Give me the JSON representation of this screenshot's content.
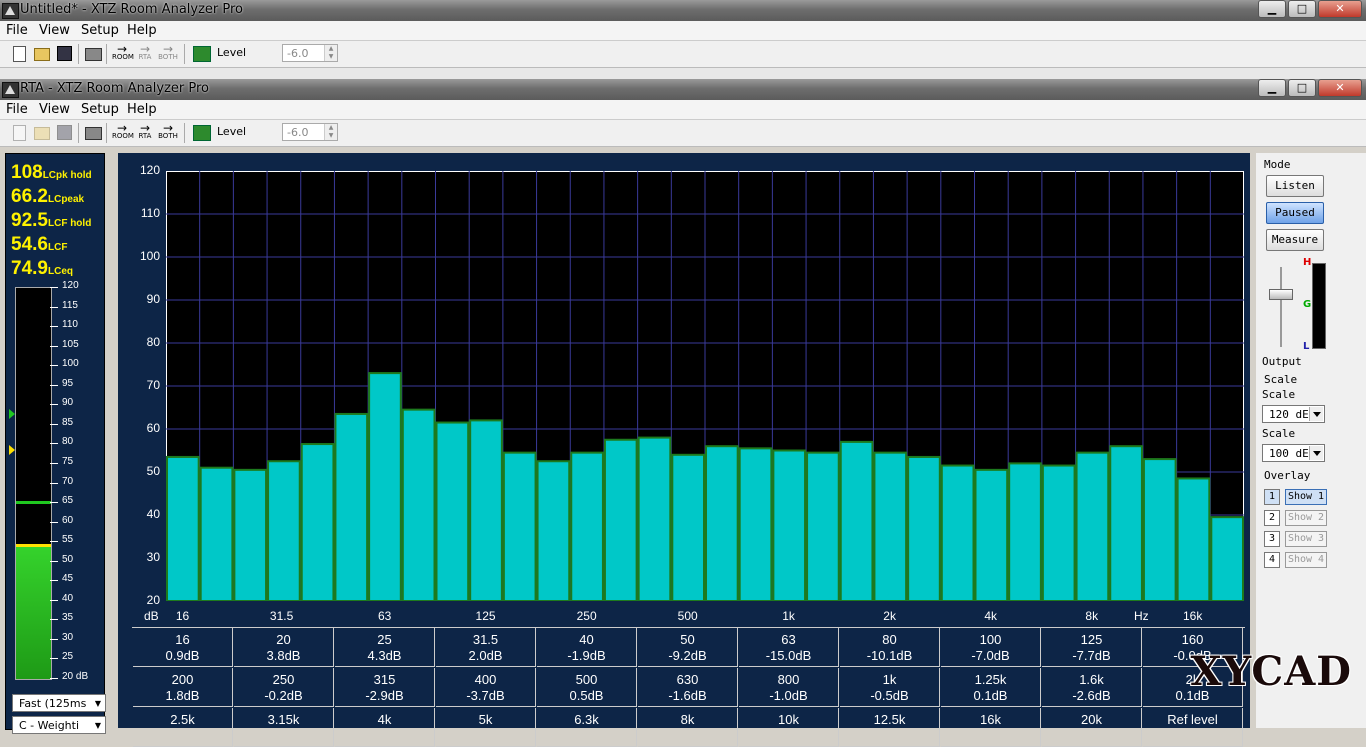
{
  "outer_window": {
    "title": "Untitled* - XTZ Room Analyzer Pro"
  },
  "inner_window": {
    "title": "RTA - XTZ Room Analyzer Pro"
  },
  "menus": [
    "File",
    "View",
    "Setup",
    "Help"
  ],
  "toolbar": {
    "room_label": "ROOM",
    "rta_label": "RTA",
    "both_label": "BOTH",
    "level_label": "Level",
    "level_value": "-6.0"
  },
  "meter": {
    "readouts": [
      {
        "value": "108",
        "label": "LCpk hold"
      },
      {
        "value": "66.2",
        "label": "LCpeak"
      },
      {
        "value": "92.5",
        "label": "LCF hold"
      },
      {
        "value": "54.6",
        "label": "LCF"
      },
      {
        "value": "74.9",
        "label": "LCeq"
      }
    ],
    "scale_labels": [
      "120",
      "115",
      "110",
      "105",
      "100",
      "95",
      "90",
      "85",
      "80",
      "75",
      "70",
      "65",
      "60",
      "55",
      "50",
      "45",
      "40",
      "35",
      "30",
      "25",
      "20 dB"
    ],
    "fill_level_db": 54,
    "peak_hold_db": 65,
    "speed_option": "Fast (125ms",
    "weighting_option": "C - Weighti"
  },
  "chart_data": {
    "type": "bar",
    "ylim": [
      20,
      120
    ],
    "yticks": [
      "120",
      "110",
      "100",
      "90",
      "80",
      "70",
      "60",
      "50",
      "40",
      "30",
      "20"
    ],
    "ylabel": "dB",
    "xlabel": "Hz",
    "xtick_labels": [
      "16",
      "31.5",
      "63",
      "125",
      "250",
      "500",
      "1k",
      "2k",
      "4k",
      "8k",
      "16k"
    ],
    "categories": [
      "16",
      "20",
      "25",
      "31.5",
      "40",
      "50",
      "63",
      "80",
      "100",
      "125",
      "160",
      "200",
      "250",
      "315",
      "400",
      "500",
      "630",
      "800",
      "1k",
      "1.25k",
      "1.6k",
      "2k",
      "2.5k",
      "3.15k",
      "4k",
      "5k",
      "6.3k",
      "8k",
      "10k",
      "12.5k",
      "16k",
      "20k"
    ],
    "values": [
      53.5,
      51,
      50.5,
      52.5,
      56.5,
      63.5,
      73,
      64.5,
      61.5,
      62,
      54.5,
      52.5,
      54.5,
      57.5,
      58,
      54,
      56,
      55.5,
      55,
      54.5,
      57,
      54.5,
      53.5,
      51.5,
      50.5,
      52,
      51.5,
      54.5,
      56,
      53,
      48.5,
      39.5
    ],
    "bar_color": "#00c8c8",
    "grid": true
  },
  "freq_table": [
    [
      {
        "f": "16",
        "v": "0.9dB"
      },
      {
        "f": "20",
        "v": "3.8dB"
      },
      {
        "f": "25",
        "v": "4.3dB"
      },
      {
        "f": "31.5",
        "v": "2.0dB"
      },
      {
        "f": "40",
        "v": "-1.9dB"
      },
      {
        "f": "50",
        "v": "-9.2dB"
      },
      {
        "f": "63",
        "v": "-15.0dB"
      },
      {
        "f": "80",
        "v": "-10.1dB"
      },
      {
        "f": "100",
        "v": "-7.0dB"
      },
      {
        "f": "125",
        "v": "-7.7dB"
      },
      {
        "f": "160",
        "v": "-0.0dB"
      }
    ],
    [
      {
        "f": "200",
        "v": "1.8dB"
      },
      {
        "f": "250",
        "v": "-0.2dB"
      },
      {
        "f": "315",
        "v": "-2.9dB"
      },
      {
        "f": "400",
        "v": "-3.7dB"
      },
      {
        "f": "500",
        "v": "0.5dB"
      },
      {
        "f": "630",
        "v": "-1.6dB"
      },
      {
        "f": "800",
        "v": "-1.0dB"
      },
      {
        "f": "1k",
        "v": "-0.5dB"
      },
      {
        "f": "1.25k",
        "v": "0.1dB"
      },
      {
        "f": "1.6k",
        "v": "-2.6dB"
      },
      {
        "f": "2k",
        "v": "0.1dB"
      }
    ],
    [
      {
        "f": "2.5k",
        "v": ""
      },
      {
        "f": "3.15k",
        "v": ""
      },
      {
        "f": "4k",
        "v": ""
      },
      {
        "f": "5k",
        "v": ""
      },
      {
        "f": "6.3k",
        "v": ""
      },
      {
        "f": "8k",
        "v": ""
      },
      {
        "f": "10k",
        "v": ""
      },
      {
        "f": "12.5k",
        "v": ""
      },
      {
        "f": "16k",
        "v": ""
      },
      {
        "f": "20k",
        "v": ""
      },
      {
        "f": "Ref level",
        "v": ""
      }
    ]
  ],
  "right_panel": {
    "mode_label": "Mode",
    "listen": "Listen",
    "paused": "Paused",
    "measure": "Measure",
    "output_label": "Output",
    "h_label": "H",
    "g_label": "G",
    "l_label": "L",
    "scale_group": "Scale",
    "scale1_label": "Scale",
    "scale1_value": "120 dE",
    "scale2_label": "Scale",
    "scale2_value": "100 dE",
    "overlay_label": "Overlay",
    "overlays": [
      {
        "num": "1",
        "label": "Show 1"
      },
      {
        "num": "2",
        "label": "Show 2"
      },
      {
        "num": "3",
        "label": "Show 3"
      },
      {
        "num": "4",
        "label": "Show 4"
      }
    ]
  },
  "watermark": "XYCAD"
}
